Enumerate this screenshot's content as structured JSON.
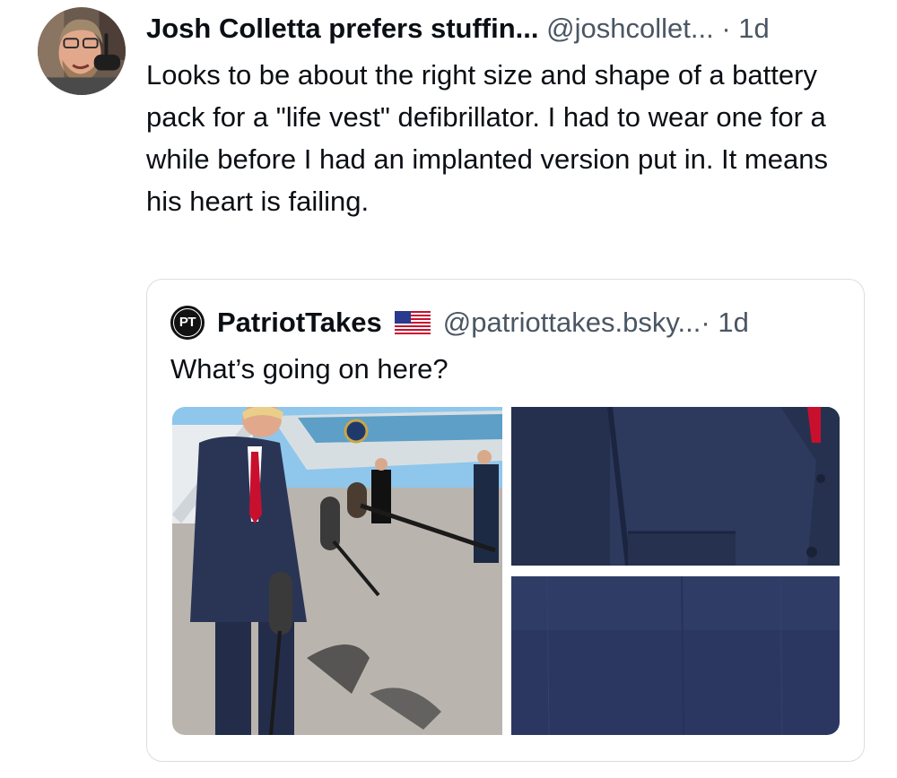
{
  "post": {
    "author_name": "Josh Colletta prefers stuffin...",
    "handle": "@joshcollet...",
    "time": "· 1d",
    "text": "Looks to be about the right size and shape of a battery pack for a \"life vest\" defibrillator.  I had to wear one for a while before I had an implanted version put in.  It means his heart is failing."
  },
  "quote": {
    "avatar_text": "PT",
    "author_name": "PatriotTakes",
    "handle": "@patriottakes.bsky...",
    "time": "· 1d",
    "text": "What’s going on here?"
  },
  "colors": {
    "text": "#0b0f14",
    "secondary_text": "#4a5663",
    "border": "#d9dee4",
    "suit_navy": "#2a3556",
    "tie_red": "#c8102e"
  },
  "icons": [
    "user-avatar",
    "patriottakes-avatar",
    "us-flag-icon"
  ]
}
